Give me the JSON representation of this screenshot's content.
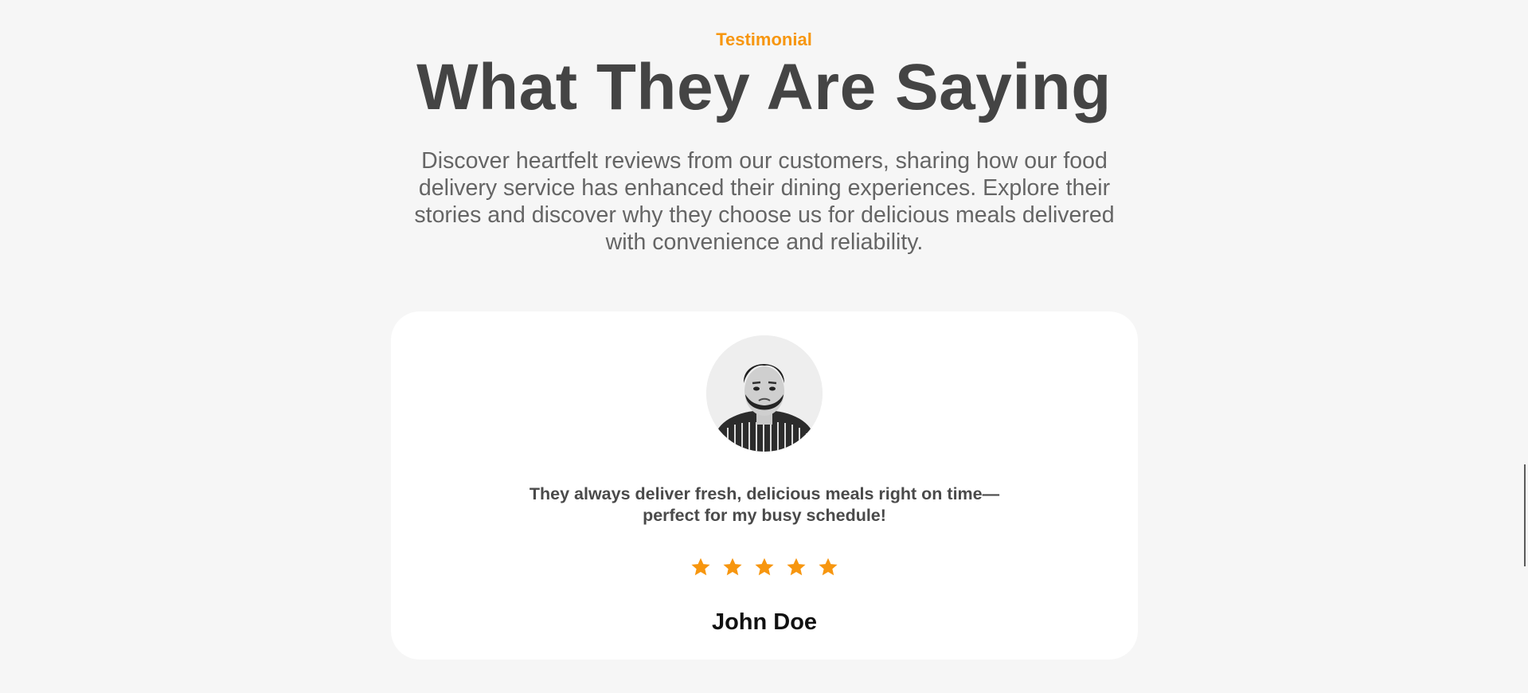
{
  "section": {
    "eyebrow": "Testimonial",
    "title": "What They Are Saying",
    "description": "Discover heartfelt reviews from our customers, sharing how our food delivery service has enhanced their dining experiences. Explore their stories and discover why they choose us for delicious meals delivered with convenience and reliability."
  },
  "testimonial": {
    "quote": "They always deliver fresh, delicious meals right on time—perfect for my busy schedule!",
    "rating": 5,
    "name": "John Doe",
    "avatar_icon": "user-avatar"
  },
  "colors": {
    "accent": "#f7960f",
    "heading": "#444444",
    "text": "#656565",
    "background": "#f6f6f6",
    "card": "#ffffff"
  },
  "icons": {
    "star": "star-icon"
  }
}
